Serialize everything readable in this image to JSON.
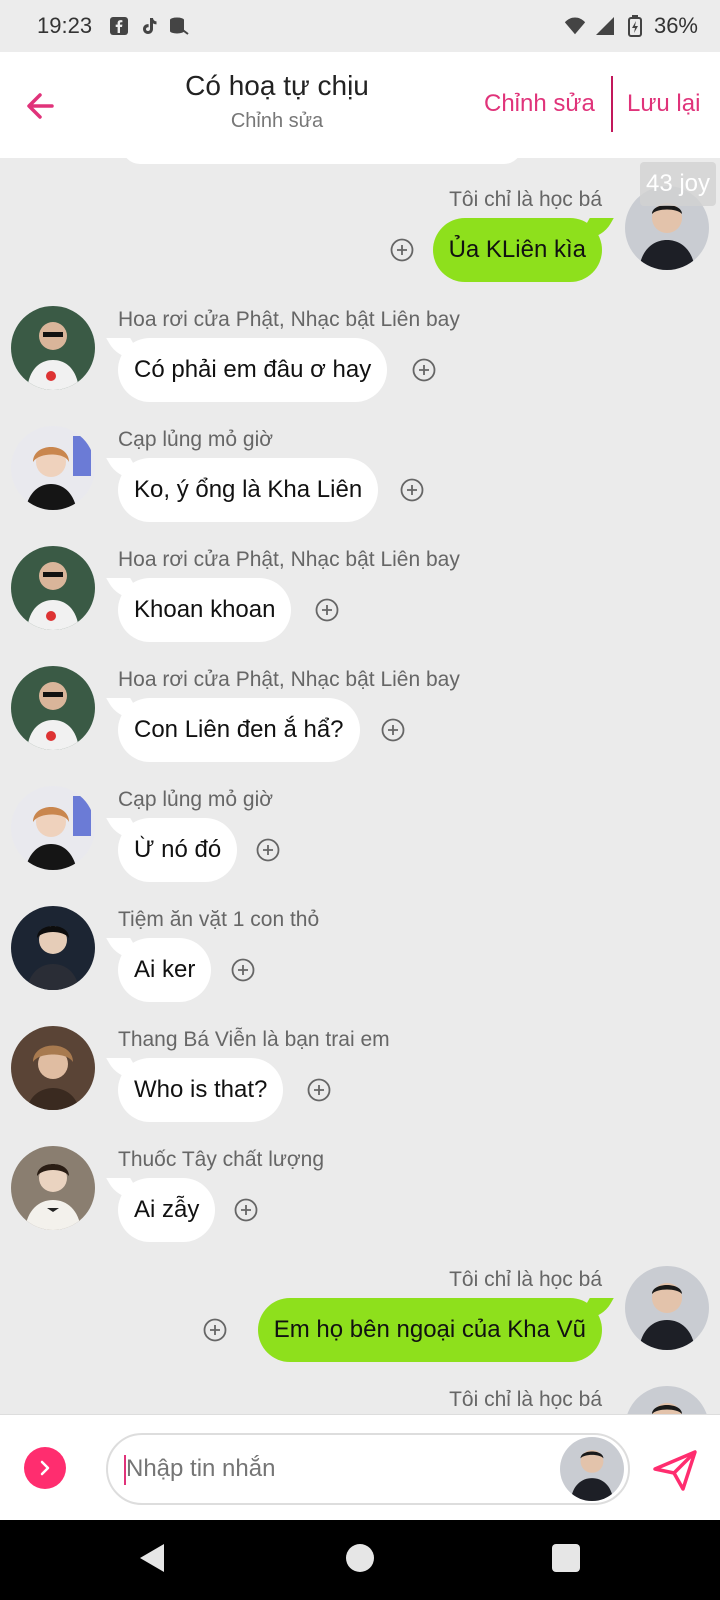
{
  "status_bar": {
    "time": "19:23",
    "battery": "36%"
  },
  "header": {
    "title": "Có hoạ tự chịu",
    "subtitle": "Chỉnh sửa",
    "edit_label": "Chỉnh sửa",
    "save_label": "Lưu lại"
  },
  "chat": {
    "badge": "43 joy",
    "messages": [
      {
        "side": "right",
        "sender": "Tôi chỉ là học bá",
        "text": "Ủa KLiên kìa"
      },
      {
        "side": "left",
        "sender": "Hoa rơi cửa Phật, Nhạc bật Liên bay",
        "text": "Có phải em đâu ơ hay"
      },
      {
        "side": "left",
        "sender": "Cạp lủng mỏ giờ",
        "text": "Ko, ý ổng là Kha Liên"
      },
      {
        "side": "left",
        "sender": "Hoa rơi cửa Phật, Nhạc bật Liên bay",
        "text": "Khoan khoan"
      },
      {
        "side": "left",
        "sender": "Hoa rơi cửa Phật, Nhạc bật Liên bay",
        "text": "Con Liên đen ắ hẩ?"
      },
      {
        "side": "left",
        "sender": "Cạp lủng mỏ giờ",
        "text": "Ừ nó đó"
      },
      {
        "side": "left",
        "sender": "Tiệm ăn vặt 1 con thỏ",
        "text": "Ai ker"
      },
      {
        "side": "left",
        "sender": "Thang Bá Viễn là bạn trai em",
        "text": "Who is that?"
      },
      {
        "side": "left",
        "sender": "Thuốc Tây chất lượng",
        "text": "Ai zẫy"
      },
      {
        "side": "right",
        "sender": "Tôi chỉ là học bá",
        "text": "Em họ bên ngoại của Kha Vũ"
      },
      {
        "side": "right",
        "sender": "Tôi chỉ là học bá",
        "text": ""
      }
    ]
  },
  "input": {
    "placeholder": "Nhập tin nhắn"
  },
  "colors": {
    "accent": "#e0337a",
    "my_bubble": "#8ee01c",
    "other_bubble": "#ffffff",
    "background": "#ebebeb"
  }
}
